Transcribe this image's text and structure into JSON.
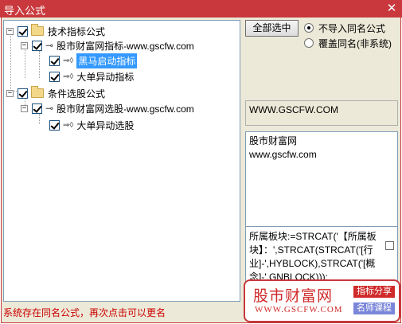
{
  "window": {
    "title": "导入公式",
    "close_glyph": "✕"
  },
  "tree": {
    "nodes": [
      {
        "label": "技术指标公式"
      },
      {
        "label": "股市财富网指标-www.gscfw.com"
      },
      {
        "label": "黑马启动指标",
        "selected": true
      },
      {
        "label": "大单异动指标"
      },
      {
        "label": "条件选股公式"
      },
      {
        "label": "股市财富网选股-www.gscfw.com"
      },
      {
        "label": "大单异动选股"
      }
    ]
  },
  "controls": {
    "select_all": "全部选中",
    "radio_no_import": "不导入同名公式",
    "radio_overwrite": "覆盖同名(非系统)"
  },
  "info": {
    "url": "WWW.GSCFW.COM",
    "desc_line1": "股市财富网",
    "desc_line2": "www.gscfw.com",
    "code": "所属板块:=STRCAT('【所属板块】：',STRCAT(STRCAT('[行业]-',HYBLOCK),STRCAT('[概念]-',GNBLOCK)));"
  },
  "status": "系统存在同名公式，再次点击可以更名",
  "watermark": {
    "name": "股市财富网",
    "url": "WWW.GSCFW.COM",
    "tag1": "指标分享",
    "tag2": "名师课程"
  }
}
